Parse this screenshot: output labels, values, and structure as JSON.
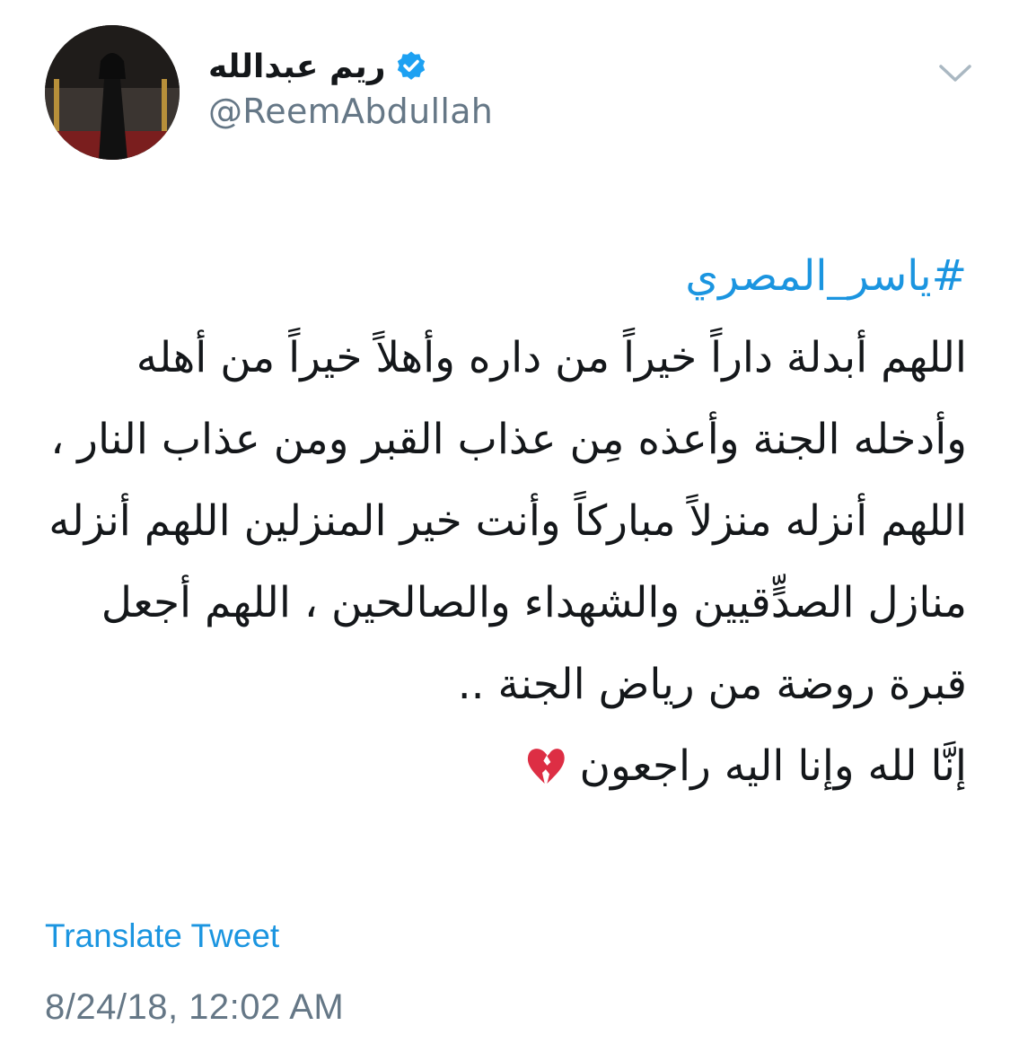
{
  "author": {
    "display_name": "ريم عبدالله",
    "handle": "@ReemAbdullah",
    "verified": true,
    "avatar_icon": "profile-photo",
    "verified_icon": "verified-badge-icon",
    "verified_color": "#1da1f2"
  },
  "menu": {
    "icon": "chevron-down-icon"
  },
  "tweet": {
    "hashtag": "#ياسر_المصري",
    "text": "اللهم أبدلة داراً خيراً من داره وأهلاً خيراً من أهله وأدخله الجنة وأعذه مِن عذاب القبر ومن عذاب النار ، اللهم أنزله منزلاً مباركاً وأنت خير المنزلين اللهم أنزله منازل الصدٍّقيين والشهداء والصالحين ، اللهم أجعل قبرة روضة من رياض الجنة ..",
    "closing": "إنَّا لله وإنا اليه راجعون",
    "emoji_icon": "broken-heart-icon"
  },
  "footer": {
    "translate_label": "Translate Tweet",
    "timestamp": "8/24/18, 12:02 AM"
  },
  "colors": {
    "link": "#1b95e0",
    "muted": "#657786",
    "text": "#14171a",
    "emoji": "#dd2e44"
  }
}
